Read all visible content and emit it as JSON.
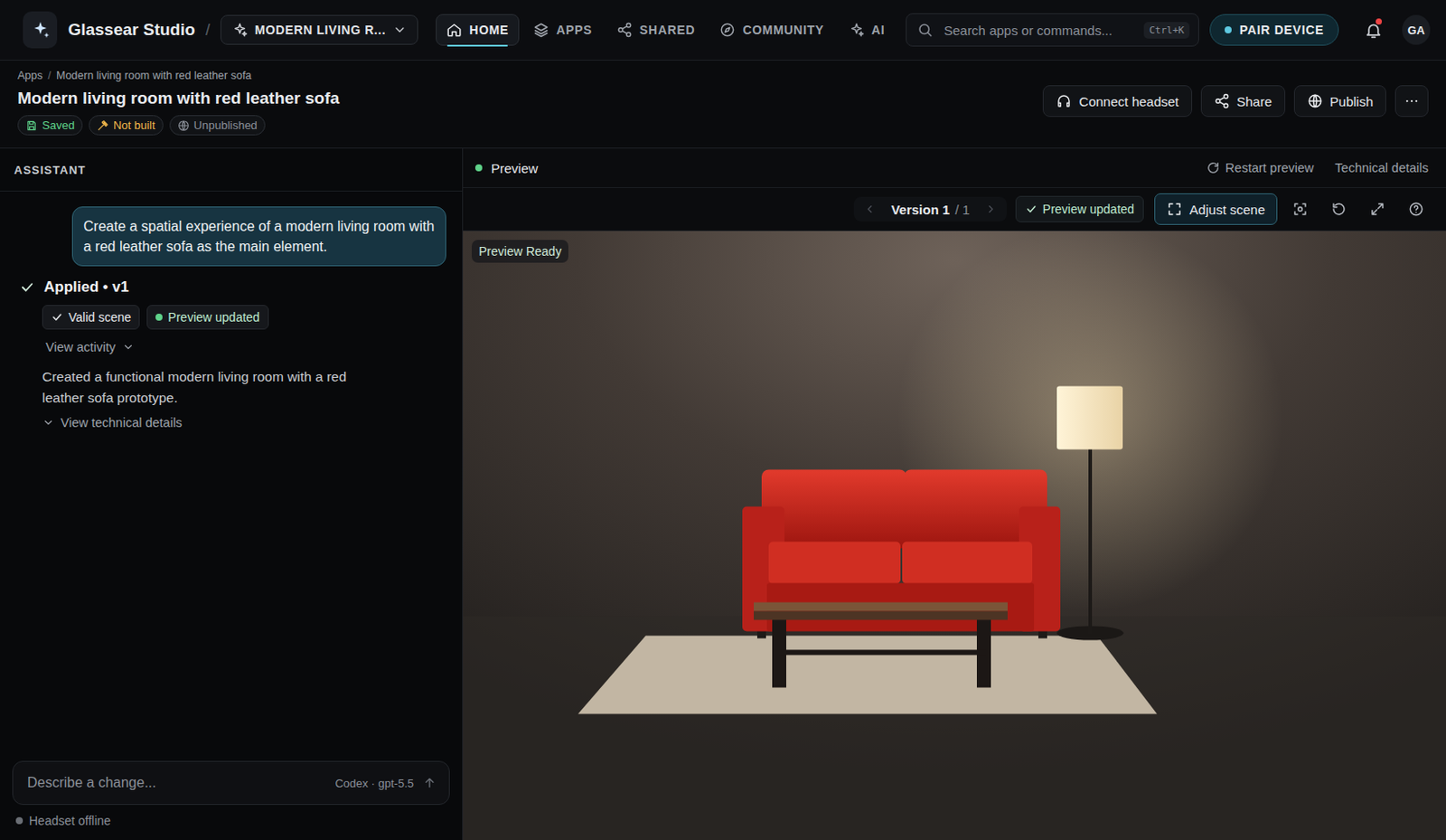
{
  "app": {
    "name": "Glassear Studio",
    "separator": "/"
  },
  "project": {
    "label": "MODERN LIVING R..."
  },
  "nav": [
    {
      "label": "HOME",
      "kind": "home",
      "selected": true
    },
    {
      "label": "APPS",
      "kind": "layers",
      "selected": false
    },
    {
      "label": "SHARED",
      "kind": "share",
      "selected": false
    },
    {
      "label": "COMMUNITY",
      "kind": "compass",
      "selected": false
    },
    {
      "label": "AI",
      "kind": "sparkle",
      "selected": false
    }
  ],
  "search": {
    "placeholder": "Search apps or commands...",
    "shortcut": "Ctrl+K"
  },
  "pair_button": "PAIR DEVICE",
  "notifications": {
    "unread": true
  },
  "avatar": "GA",
  "breadcrumb": {
    "items": [
      "Apps",
      "Modern living room with red leather sofa"
    ],
    "separator": "/"
  },
  "title": "Modern living room with red leather sofa",
  "badges": [
    {
      "label": "Saved",
      "kind": "save",
      "color": "#5fd38a"
    },
    {
      "label": "Not built",
      "kind": "hammer",
      "color": "#f2b84b"
    },
    {
      "label": "Unpublished",
      "kind": "globe",
      "color": "#8a8f98"
    }
  ],
  "actions": [
    {
      "label": "Connect headset",
      "kind": "headset"
    },
    {
      "label": "Share",
      "kind": "share"
    },
    {
      "label": "Publish",
      "kind": "globe"
    }
  ],
  "assistant": {
    "heading": "ASSISTANT",
    "messages": [
      {
        "role": "user",
        "text": "Create a spatial experience of a modern living room with a red leather sofa as the main element."
      }
    ],
    "result": {
      "status": "Applied • v1",
      "chips": [
        {
          "label": "Valid scene",
          "kind": "check"
        },
        {
          "label": "Preview updated",
          "kind": "dot"
        }
      ],
      "activity_toggle": {
        "label": "View activity",
        "expanded": false
      },
      "summary": "Created a functional modern living room with a red leather sofa prototype.",
      "details_toggle": {
        "label": "View technical details",
        "expanded": false
      }
    },
    "input": {
      "placeholder": "Describe a change...",
      "model": "Codex · gpt-5.5"
    },
    "headset": {
      "label": "Headset offline",
      "online": false
    }
  },
  "preview": {
    "title": "Preview",
    "live": true,
    "restart": "Restart preview",
    "details": "Technical details",
    "version": {
      "label": "Version 1",
      "total": "/ 1",
      "prev_disabled": true,
      "next_disabled": true
    },
    "status": "Preview updated",
    "adjust": {
      "label": "Adjust scene",
      "selected": true
    },
    "badge": "Preview Ready"
  }
}
